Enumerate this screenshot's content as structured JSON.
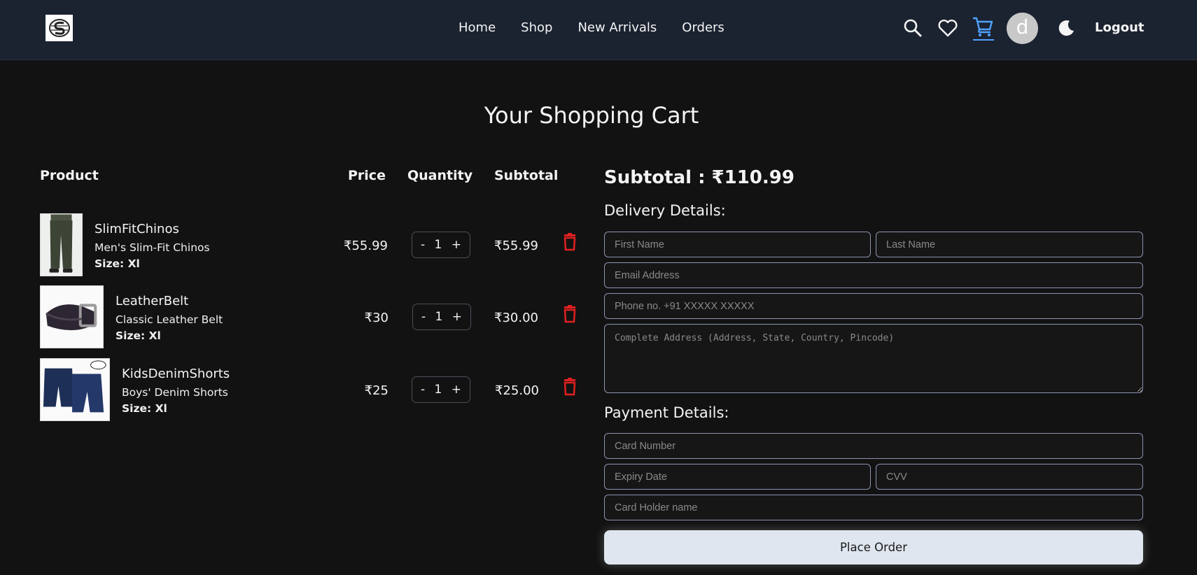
{
  "nav": {
    "links": [
      "Home",
      "Shop",
      "New Arrivals",
      "Orders"
    ],
    "avatar_letter": "d",
    "logout_label": "Logout",
    "icons": [
      "search-icon",
      "heart-icon",
      "cart-icon",
      "moon-icon"
    ],
    "active_color": "#4ea3ff"
  },
  "page": {
    "title": "Your Shopping Cart"
  },
  "cart": {
    "headers": {
      "product": "Product",
      "price": "Price",
      "quantity": "Quantity",
      "subtotal": "Subtotal"
    },
    "items": [
      {
        "name": "SlimFitChinos",
        "description": "Men's Slim-Fit Chinos",
        "size": "Size: Xl",
        "price": "₹55.99",
        "quantity": "1",
        "subtotal": "₹55.99"
      },
      {
        "name": "LeatherBelt",
        "description": "Classic Leather Belt",
        "size": "Size: Xl",
        "price": "₹30",
        "quantity": "1",
        "subtotal": "₹30.00"
      },
      {
        "name": "KidsDenimShorts",
        "description": "Boys' Denim Shorts",
        "size": "Size: Xl",
        "price": "₹25",
        "quantity": "1",
        "subtotal": "₹25.00"
      }
    ],
    "qty_minus": "-",
    "qty_plus": "+",
    "delete_color": "#e02020"
  },
  "checkout": {
    "subtotal_label": "Subtotal : ₹110.99",
    "delivery_title": "Delivery Details:",
    "payment_title": "Payment Details:",
    "placeholders": {
      "first_name": "First Name",
      "last_name": "Last Name",
      "email": "Email Address",
      "phone": "Phone no. +91 XXXXX XXXXX",
      "address": "Complete Address (Address, State, Country, Pincode)",
      "card_number": "Card Number",
      "expiry": "Expiry Date",
      "cvv": "CVV",
      "card_holder": "Card Holder name"
    },
    "place_order_label": "Place Order"
  }
}
